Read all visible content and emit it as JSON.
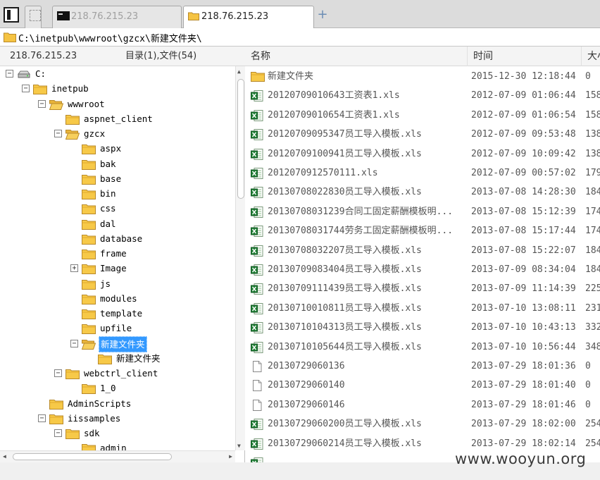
{
  "tabs": [
    {
      "label": "218.76.215.23",
      "icon": "terminal-icon"
    },
    {
      "label": "218.76.215.23",
      "icon": "folder-icon",
      "active": true
    }
  ],
  "add_tab_label": "+",
  "path": "C:\\inetpub\\wwwroot\\gzcx\\新建文件夹\\",
  "left_header": {
    "host": "218.76.215.23",
    "count": "目录(1),文件(54)"
  },
  "tree": [
    {
      "label": "C:",
      "depth": 0,
      "toggle": "-",
      "icon": "drive-icon"
    },
    {
      "label": "inetpub",
      "depth": 1,
      "toggle": "-",
      "icon": "folder-icon"
    },
    {
      "label": "wwwroot",
      "depth": 2,
      "toggle": "-",
      "icon": "folder-open-icon"
    },
    {
      "label": "aspnet_client",
      "depth": 3,
      "toggle": "",
      "icon": "folder-icon"
    },
    {
      "label": "gzcx",
      "depth": 3,
      "toggle": "-",
      "icon": "folder-open-icon"
    },
    {
      "label": "aspx",
      "depth": 4,
      "toggle": "",
      "icon": "folder-icon"
    },
    {
      "label": "bak",
      "depth": 4,
      "toggle": "",
      "icon": "folder-icon"
    },
    {
      "label": "base",
      "depth": 4,
      "toggle": "",
      "icon": "folder-icon"
    },
    {
      "label": "bin",
      "depth": 4,
      "toggle": "",
      "icon": "folder-icon"
    },
    {
      "label": "css",
      "depth": 4,
      "toggle": "",
      "icon": "folder-icon"
    },
    {
      "label": "dal",
      "depth": 4,
      "toggle": "",
      "icon": "folder-icon"
    },
    {
      "label": "database",
      "depth": 4,
      "toggle": "",
      "icon": "folder-icon"
    },
    {
      "label": "frame",
      "depth": 4,
      "toggle": "",
      "icon": "folder-icon"
    },
    {
      "label": "Image",
      "depth": 4,
      "toggle": "+",
      "icon": "folder-icon"
    },
    {
      "label": "js",
      "depth": 4,
      "toggle": "",
      "icon": "folder-icon"
    },
    {
      "label": "modules",
      "depth": 4,
      "toggle": "",
      "icon": "folder-icon"
    },
    {
      "label": "template",
      "depth": 4,
      "toggle": "",
      "icon": "folder-icon"
    },
    {
      "label": "upfile",
      "depth": 4,
      "toggle": "",
      "icon": "folder-icon"
    },
    {
      "label": "新建文件夹",
      "depth": 4,
      "toggle": "-",
      "icon": "folder-open-icon",
      "selected": true
    },
    {
      "label": "新建文件夹",
      "depth": 5,
      "toggle": "",
      "icon": "folder-icon"
    },
    {
      "label": "webctrl_client",
      "depth": 3,
      "toggle": "-",
      "icon": "folder-icon"
    },
    {
      "label": "1_0",
      "depth": 4,
      "toggle": "",
      "icon": "folder-icon"
    },
    {
      "label": "AdminScripts",
      "depth": 2,
      "toggle": "",
      "icon": "folder-icon"
    },
    {
      "label": "iissamples",
      "depth": 2,
      "toggle": "-",
      "icon": "folder-icon"
    },
    {
      "label": "sdk",
      "depth": 3,
      "toggle": "-",
      "icon": "folder-icon"
    },
    {
      "label": "admin",
      "depth": 4,
      "toggle": "",
      "icon": "folder-icon"
    }
  ],
  "columns": {
    "name": "名称",
    "time": "时间",
    "size": "大小"
  },
  "files": [
    {
      "name": "新建文件夹",
      "time": "2015-12-30 12:18:44",
      "size": "0",
      "icon": "folder-icon"
    },
    {
      "name": "20120709010643工资表1.xls",
      "time": "2012-07-09 01:06:44",
      "size": "158",
      "icon": "excel-icon"
    },
    {
      "name": "20120709010654工资表1.xls",
      "time": "2012-07-09 01:06:54",
      "size": "158",
      "icon": "excel-icon"
    },
    {
      "name": "20120709095347员工导入模板.xls",
      "time": "2012-07-09 09:53:48",
      "size": "138",
      "icon": "excel-icon"
    },
    {
      "name": "20120709100941员工导入模板.xls",
      "time": "2012-07-09 10:09:42",
      "size": "138",
      "icon": "excel-icon"
    },
    {
      "name": "2012070912570111.xls",
      "time": "2012-07-09 00:57:02",
      "size": "179",
      "icon": "excel-icon"
    },
    {
      "name": "20130708022830员工导入模板.xls",
      "time": "2013-07-08 14:28:30",
      "size": "184",
      "icon": "excel-icon"
    },
    {
      "name": "20130708031239合同工固定薪酬模板明...",
      "time": "2013-07-08 15:12:39",
      "size": "174",
      "icon": "excel-icon"
    },
    {
      "name": "20130708031744劳务工固定薪酬模板明...",
      "time": "2013-07-08 15:17:44",
      "size": "174",
      "icon": "excel-icon"
    },
    {
      "name": "20130708032207员工导入模板.xls",
      "time": "2013-07-08 15:22:07",
      "size": "184",
      "icon": "excel-icon"
    },
    {
      "name": "20130709083404员工导入模板.xls",
      "time": "2013-07-09 08:34:04",
      "size": "184",
      "icon": "excel-icon"
    },
    {
      "name": "20130709111439员工导入模板.xls",
      "time": "2013-07-09 11:14:39",
      "size": "225",
      "icon": "excel-icon"
    },
    {
      "name": "20130710010811员工导入模板.xls",
      "time": "2013-07-10 13:08:11",
      "size": "231",
      "icon": "excel-icon"
    },
    {
      "name": "20130710104313员工导入模板.xls",
      "time": "2013-07-10 10:43:13",
      "size": "332",
      "icon": "excel-icon"
    },
    {
      "name": "20130710105644员工导入模板.xls",
      "time": "2013-07-10 10:56:44",
      "size": "348",
      "icon": "excel-icon"
    },
    {
      "name": "20130729060136",
      "time": "2013-07-29 18:01:36",
      "size": "0",
      "icon": "file-icon"
    },
    {
      "name": "20130729060140",
      "time": "2013-07-29 18:01:40",
      "size": "0",
      "icon": "file-icon"
    },
    {
      "name": "20130729060146",
      "time": "2013-07-29 18:01:46",
      "size": "0",
      "icon": "file-icon"
    },
    {
      "name": "20130729060200员工导入模板.xls",
      "time": "2013-07-29 18:02:00",
      "size": "254",
      "icon": "excel-icon"
    },
    {
      "name": "20130729060214员工导入模板.xls",
      "time": "2013-07-29 18:02:14",
      "size": "254",
      "icon": "excel-icon"
    },
    {
      "name": "",
      "time": "",
      "size": "",
      "icon": "excel-icon"
    }
  ],
  "watermark": "www.wooyun.org"
}
